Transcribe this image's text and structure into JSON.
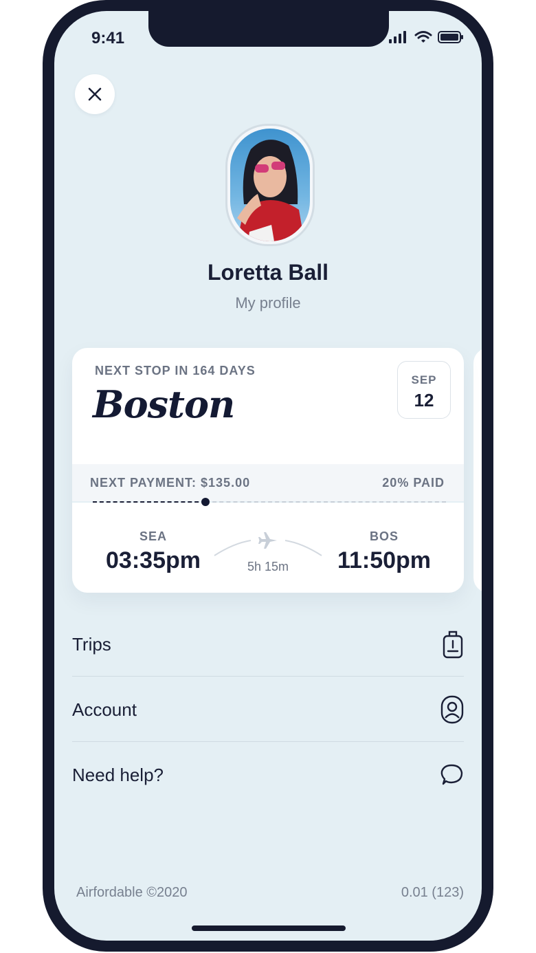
{
  "status_bar": {
    "time": "9:41"
  },
  "profile": {
    "name": "Loretta Ball",
    "subtitle": "My profile"
  },
  "trip_card": {
    "next_stop": "NEXT STOP IN 164 DAYS",
    "city": "Boston",
    "date": {
      "month": "SEP",
      "day": "12"
    },
    "payment": "NEXT PAYMENT: $135.00",
    "paid": "20% PAID",
    "paid_fraction": 0.32,
    "departure": {
      "code": "SEA",
      "time": "03:35pm"
    },
    "arrival": {
      "code": "BOS",
      "time": "11:50pm"
    },
    "duration": "5h 15m"
  },
  "menu": {
    "items": [
      {
        "label": "Trips",
        "icon": "luggage-icon"
      },
      {
        "label": "Account",
        "icon": "user-icon"
      },
      {
        "label": "Need help?",
        "icon": "chat-bubble-icon"
      }
    ]
  },
  "footer": {
    "copyright": "Airfordable ©2020",
    "version": "0.01 (123)"
  },
  "colors": {
    "screen_bg": "#e4eff4",
    "ink": "#1a1f36",
    "muted": "#6b7383",
    "frame": "#151a2e"
  }
}
